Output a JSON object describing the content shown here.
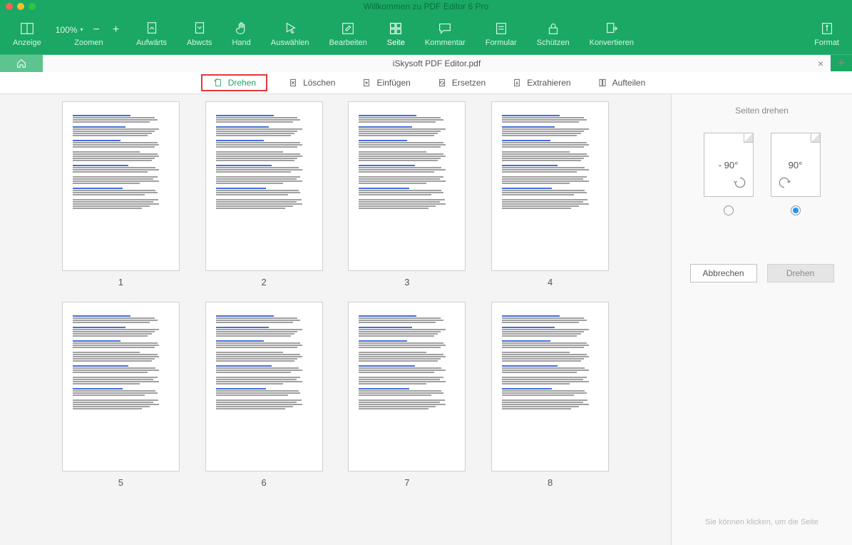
{
  "window": {
    "title": "Willkommen zu PDF Editor 6 Pro"
  },
  "toolbar": {
    "items": [
      {
        "label": "Anzeige"
      },
      {
        "label": "Zoomen",
        "zoom_value": "100%",
        "zoom_minus": "−",
        "zoom_plus": "+"
      },
      {
        "label": "Aufwärts"
      },
      {
        "label": "Abwcts"
      },
      {
        "label": "Hand"
      },
      {
        "label": "Auswählen"
      },
      {
        "label": "Bearbeiten"
      },
      {
        "label": "Seite"
      },
      {
        "label": "Kommentar"
      },
      {
        "label": "Formular"
      },
      {
        "label": "Schützen"
      },
      {
        "label": "Konvertieren"
      }
    ],
    "format": {
      "label": "Format"
    }
  },
  "tab": {
    "document_name": "iSkysoft PDF Editor.pdf"
  },
  "subtoolbar": {
    "rotate": "Drehen",
    "delete": "Löschen",
    "insert": "Einfügen",
    "replace": "Ersetzen",
    "extract": "Extrahieren",
    "split": "Aufteilen"
  },
  "pages": {
    "count": 8,
    "numbers": [
      "1",
      "2",
      "3",
      "4",
      "5",
      "6",
      "7",
      "8"
    ]
  },
  "sidebar": {
    "title": "Seiten drehen",
    "option_minus90": "- 90°",
    "option_plus90": "90°",
    "selected": "plus90",
    "cancel": "Abbrechen",
    "apply": "Drehen",
    "hint": "Sie können klicken, um die Seite"
  }
}
